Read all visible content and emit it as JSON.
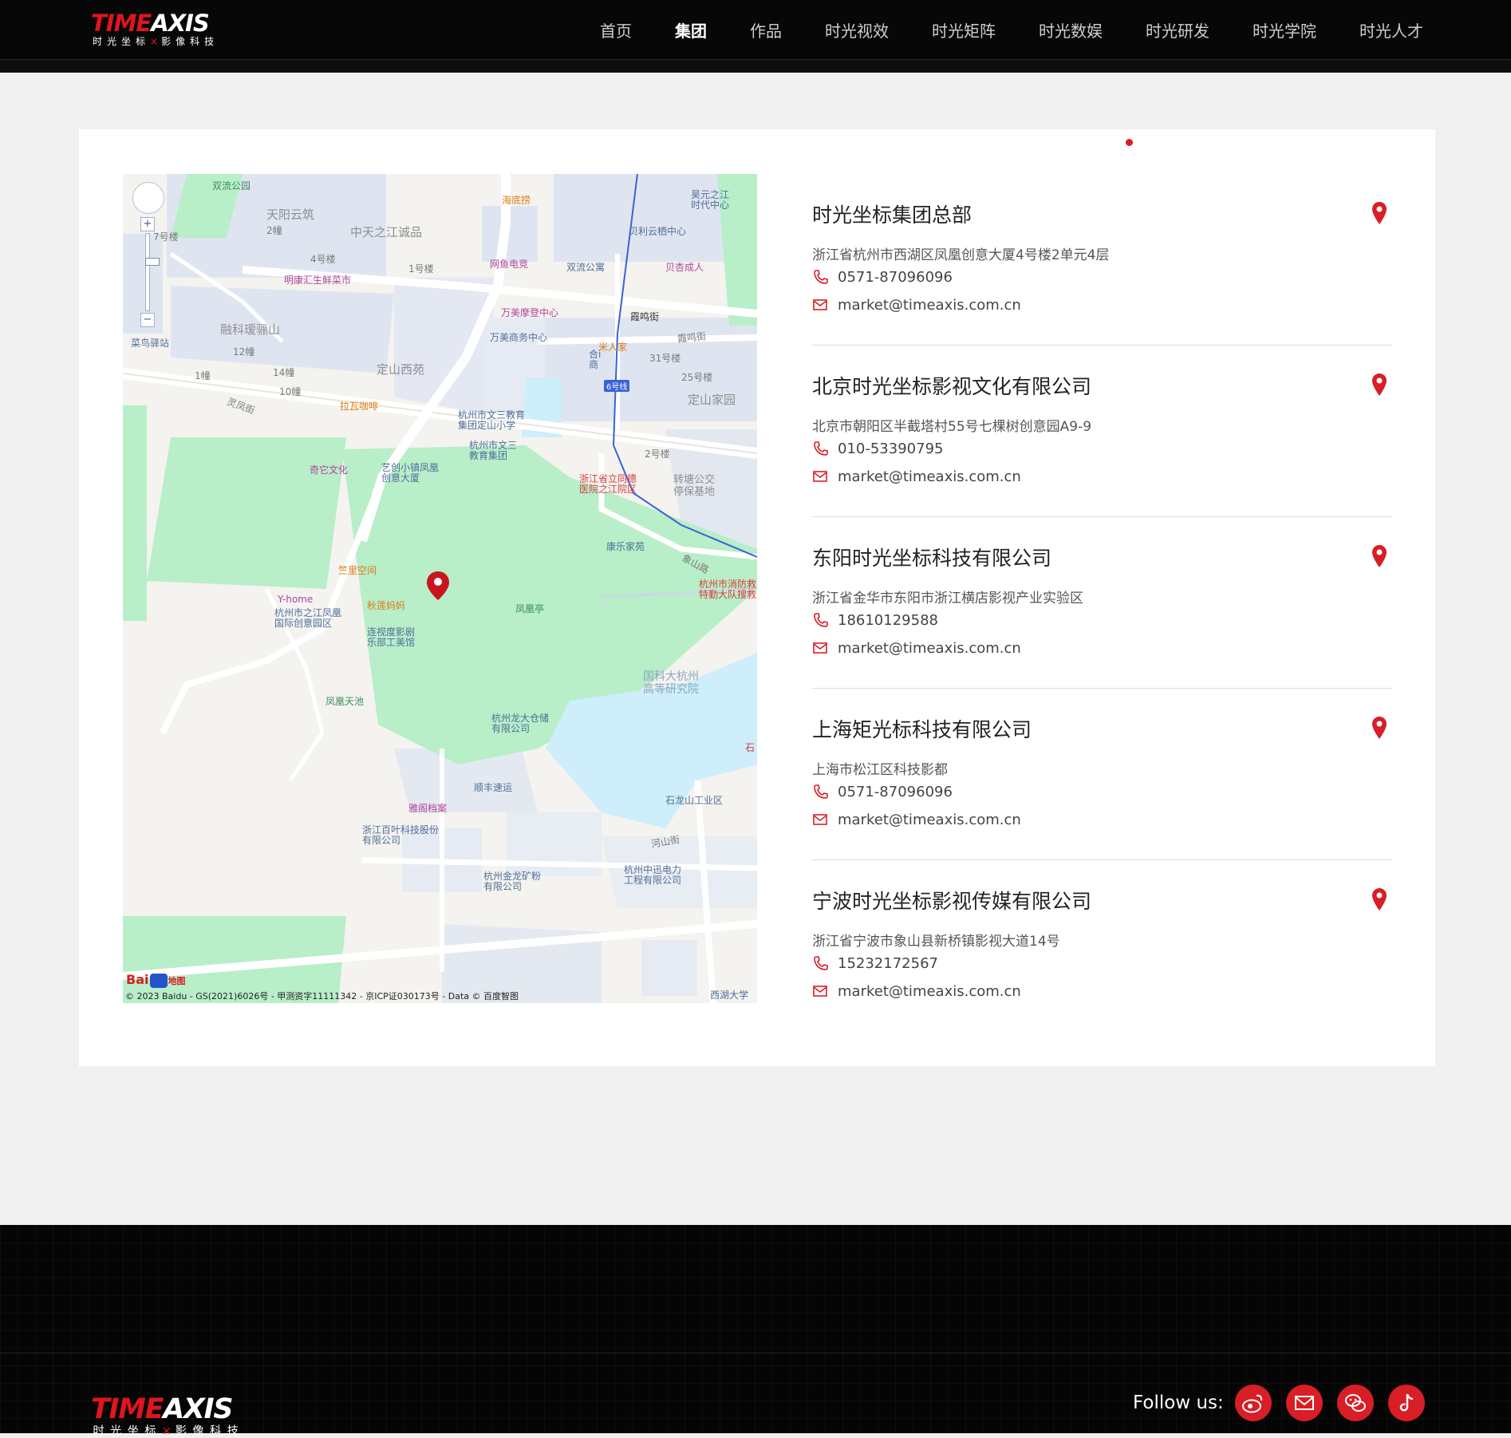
{
  "header": {
    "logo_word_a": "TIME",
    "logo_word_b": "AXIS",
    "logo_sub_a": "时光坐标",
    "logo_sub_dot": "×",
    "logo_sub_b": "影像科技",
    "nav": [
      {
        "label": "首页",
        "active": false
      },
      {
        "label": "集团",
        "active": true
      },
      {
        "label": "作品",
        "active": false
      },
      {
        "label": "时光视效",
        "active": false
      },
      {
        "label": "时光矩阵",
        "active": false
      },
      {
        "label": "时光数娱",
        "active": false
      },
      {
        "label": "时光研发",
        "active": false
      },
      {
        "label": "时光学院",
        "active": false
      },
      {
        "label": "时光人才",
        "active": false
      }
    ]
  },
  "map": {
    "labels": {
      "shuangliu_park": "双流公园",
      "tianyang": "天阳云筑",
      "zhongtian": "中天之江诚品",
      "haidilao": "海底捞",
      "jingyuan": "昊元之江\n时代中心",
      "beilike": "贝利云栖中心",
      "building7": "7号楼",
      "building2": "2幢",
      "building4": "4号楼",
      "building1a": "1号楼",
      "wangyu": "网鱼电竞",
      "shuangliu_apt": "双流公寓",
      "beixing": "贝杏成人",
      "mingkang": "明康汇生鲜菜市",
      "wanmei_center": "万美摩登中心",
      "xiaming_station": "霞鸣街",
      "ronke": "融科瑷骊山",
      "cainiao": "菜鸟驿站",
      "wanmei_biz": "万美商务中心",
      "mi_home": "米人家",
      "xiaming_street": "霞鸣街",
      "building12": "12幢",
      "building14": "14幢",
      "dingshan_west": "定山西苑",
      "hexin": "合i\n商",
      "building31": "31号楼",
      "building25": "25号楼",
      "building1b": "1幢",
      "building10": "10幢",
      "line6": "6号线",
      "dingshan_home": "定山家园",
      "lingfeng": "灵凤街",
      "lawa": "拉瓦咖啡",
      "wensan_school": "杭州市文三教育\n集团定山小学",
      "wensan_group": "杭州市文三\n教育集团",
      "building2b": "2号楼",
      "qiyi": "奇它文化",
      "yichuang": "艺创小镇凤凰\n创意大厦",
      "tongde": "浙江省立同德\n医院之江院区",
      "zhuantang": "转塘公交\n停保基地",
      "kangle": "康乐家苑",
      "xiangshan_rd": "象山路",
      "zhuli": "竺里空间",
      "fire": "杭州市消防救\n特勤大队搜救",
      "yhome": "Y-home",
      "qiulian": "秋莲妈妈",
      "fenghuang_pav": "凤凰亭",
      "fenghuang_park": "杭州市之江凤凰\n国际创意园区",
      "lianshi": "连视度影剧\n乐部工美馆",
      "guoke": "国科大杭州\n高等研究院",
      "fenghuang_pond": "凤凰天池",
      "longda": "杭州龙大仓储\n有限公司",
      "shi": "石",
      "shunfeng": "顺丰速运",
      "yage": "雅阁档案",
      "shilong": "石龙山工业区",
      "baiye": "浙江百叶科技股份\n有限公司",
      "heshan": "河山街",
      "jinlong": "杭州金龙矿粉\n有限公司",
      "zhongxun": "杭州中迅电力\n工程有限公司",
      "westlake": "西湖大学"
    },
    "baidu_text": "Bai",
    "baidu_suffix": "地图",
    "copyright": "© 2023 Baidu - GS(2021)6026号 - 甲测资字11111342 - 京ICP证030173号 - Data © 百度智图"
  },
  "offices": [
    {
      "name": "时光坐标集团总部",
      "address": "浙江省杭州市西湖区凤凰创意大厦4号楼2单元4层",
      "phone": "0571-87096096",
      "email": "market@timeaxis.com.cn"
    },
    {
      "name": "北京时光坐标影视文化有限公司",
      "address": "北京市朝阳区半截塔村55号七棵树创意园A9-9",
      "phone": "010-53390795",
      "email": "market@timeaxis.com.cn"
    },
    {
      "name": "东阳时光坐标科技有限公司",
      "address": "浙江省金华市东阳市浙江横店影视产业实验区",
      "phone": "18610129588",
      "email": "market@timeaxis.com.cn"
    },
    {
      "name": "上海矩光标科技有限公司",
      "address": "上海市松江区科技影都",
      "phone": "0571-87096096",
      "email": "market@timeaxis.com.cn"
    },
    {
      "name": "宁波时光坐标影视传媒有限公司",
      "address": "浙江省宁波市象山县新桥镇影视大道14号",
      "phone": "15232172567",
      "email": "market@timeaxis.com.cn"
    }
  ],
  "footer": {
    "follow_label": "Follow us:",
    "socials": [
      "weibo-icon",
      "mail-icon",
      "wechat-icon",
      "douyin-icon"
    ]
  },
  "colors": {
    "accent": "#d81e26",
    "header_bg": "#070707",
    "page_bg": "#f0f0f0",
    "map_green": "#b8eec8",
    "map_blue": "#dfe5f0",
    "map_water": "#cdeefa"
  }
}
